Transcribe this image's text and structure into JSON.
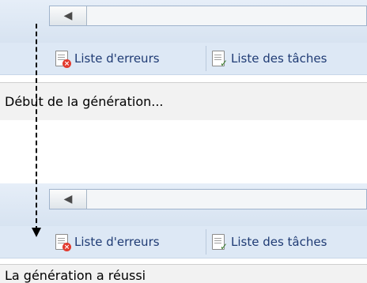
{
  "top": {
    "tabs": [
      {
        "label": "Liste d'erreurs",
        "icon": "error-list-icon"
      },
      {
        "label": "Liste des tâches",
        "icon": "task-list-icon"
      }
    ],
    "status": "Début de la génération..."
  },
  "bottom": {
    "tabs": [
      {
        "label": "Liste d'erreurs",
        "icon": "error-list-icon"
      },
      {
        "label": "Liste des tâches",
        "icon": "task-list-icon"
      }
    ],
    "status": "La génération a réussi"
  },
  "colors": {
    "tab_text": "#1f3b74",
    "status_text": "#000000"
  },
  "icons": {
    "scroll_left": "◀"
  }
}
